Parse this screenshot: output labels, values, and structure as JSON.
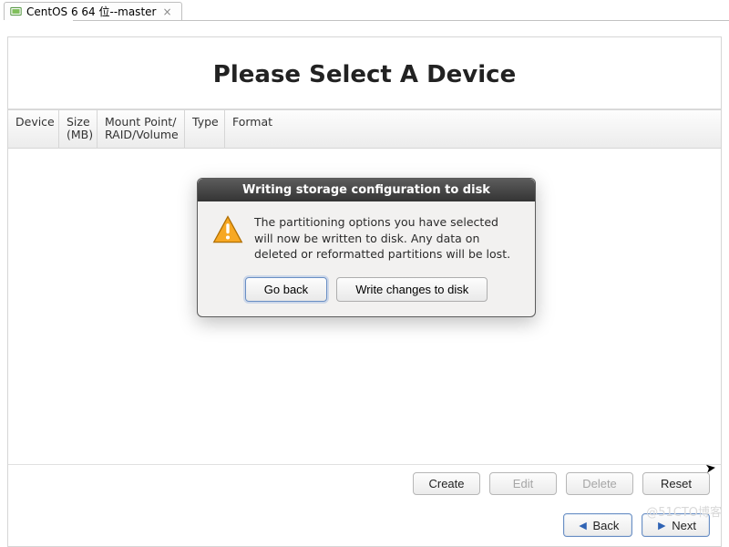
{
  "tab": {
    "label": "CentOS 6 64 位--master",
    "close_glyph": "×"
  },
  "page": {
    "title": "Please Select A Device"
  },
  "table": {
    "headers": {
      "device": "Device",
      "size": "Size\n(MB)",
      "mount": "Mount Point/\nRAID/Volume",
      "type": "Type",
      "format": "Format"
    }
  },
  "dialog": {
    "title": "Writing storage configuration to disk",
    "message": "The partitioning options you have selected will now be written to disk.  Any data on deleted or reformatted partitions will be lost.",
    "go_back_label": "Go back",
    "write_label": "Write changes to disk"
  },
  "actions": {
    "create": "Create",
    "edit": "Edit",
    "delete": "Delete",
    "reset": "Reset"
  },
  "nav": {
    "back": "Back",
    "next": "Next"
  },
  "watermark": "@51CTO博客"
}
